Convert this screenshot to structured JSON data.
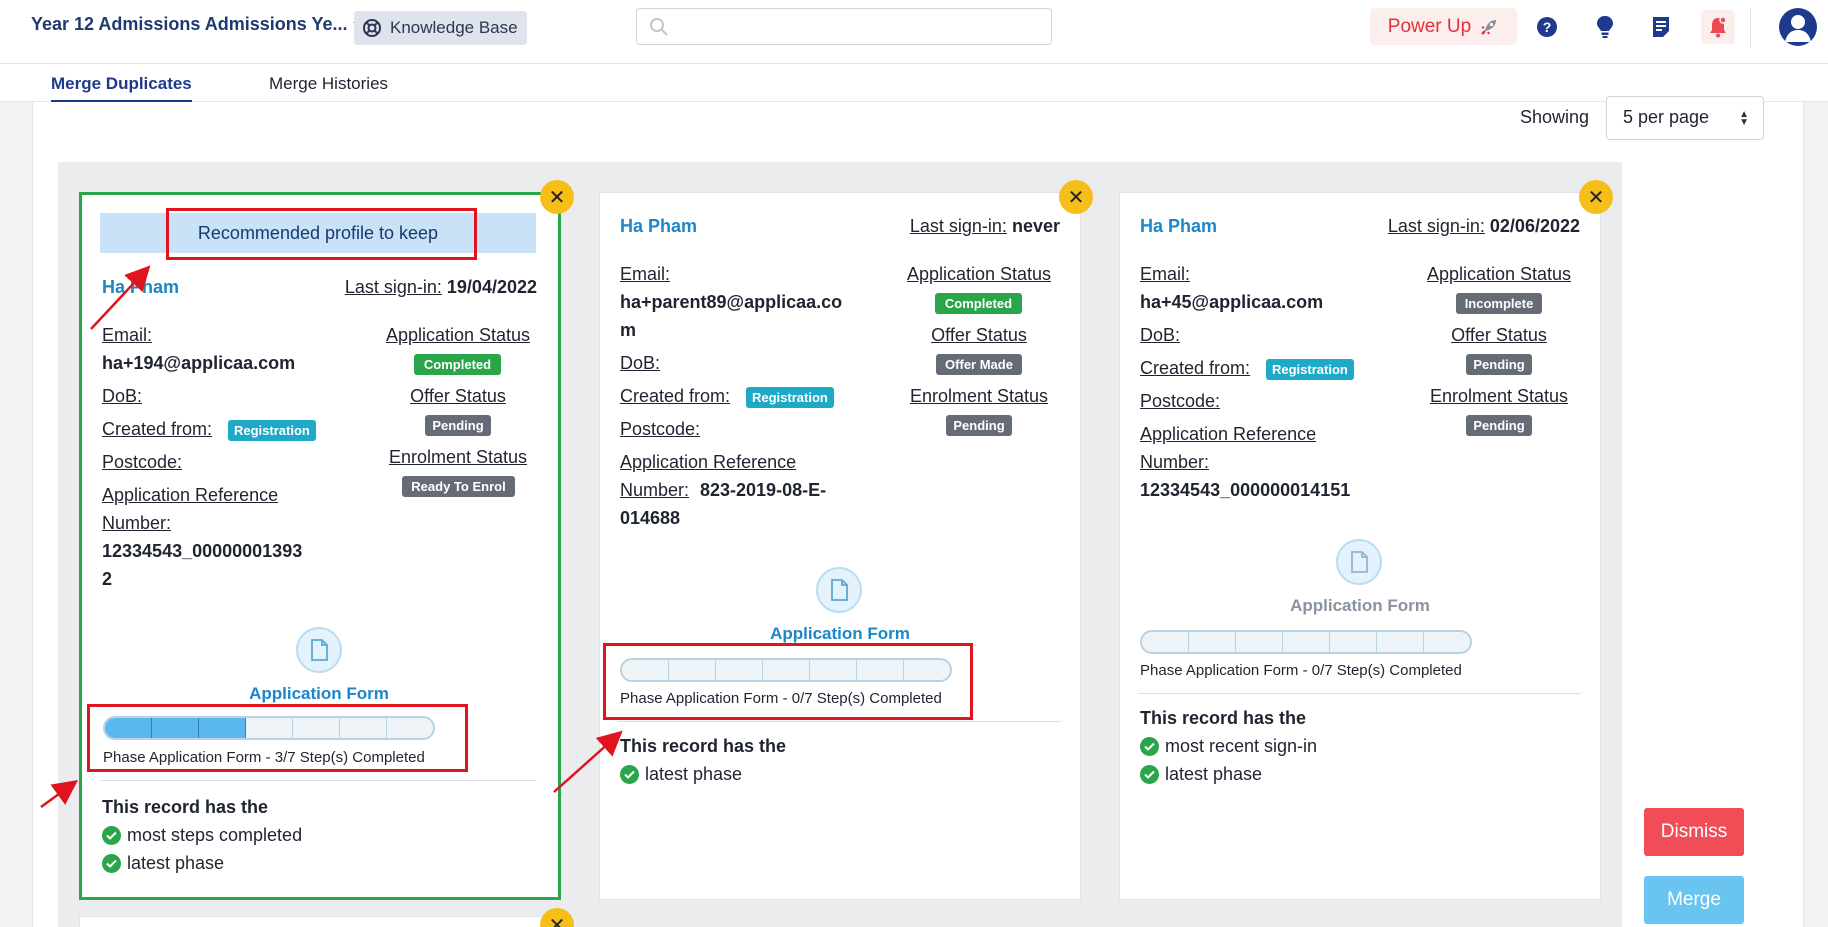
{
  "header": {
    "app_title": "Year 12 Admissions Admissions Ye...",
    "knowledge_base": "Knowledge Base",
    "search_placeholder": "",
    "power_up": "Power Up"
  },
  "tabs": [
    {
      "label": "Merge Duplicates",
      "active": true
    },
    {
      "label": "Merge Histories",
      "active": false
    }
  ],
  "paging": {
    "showing_label": "Showing",
    "per_page": "5 per page"
  },
  "labels": {
    "last_signin": "Last sign-in:",
    "email": "Email:",
    "dob": "DoB:",
    "created_from": "Created from:",
    "postcode": "Postcode:",
    "app_ref_1": "Application Reference",
    "app_ref_2": "Number:",
    "application_status": "Application Status",
    "offer_status": "Offer Status",
    "enrolment_status": "Enrolment Status",
    "record_has": "This record has the",
    "recommended": "Recommended profile to keep"
  },
  "cards": [
    {
      "name": "Ha Pham",
      "last_signin": "19/04/2022",
      "email_line1": "ha+194@applicaa.com",
      "email_line2": "",
      "created_from": "Registration",
      "ref_number_line1": "12334543_00000001393",
      "ref_number_line2": "2",
      "application_status": "Completed",
      "offer_status": "Pending",
      "enrolment_status": "Ready To Enrol",
      "phase_name": "Application Form",
      "progress_steps_completed": 3,
      "progress_steps_total": 7,
      "progress_text": "Phase Application Form - 3/7 Step(s) Completed",
      "record_items": [
        "most steps completed",
        "latest phase"
      ]
    },
    {
      "name": "Ha Pham",
      "last_signin": "never",
      "email_line1": "ha+parent89@applicaa.co",
      "email_line2": "m",
      "created_from": "Registration",
      "ref_inline": "823-2019-08-E-",
      "ref_number_line2": "014688",
      "application_status": "Completed",
      "offer_status": "Offer Made",
      "enrolment_status": "Pending",
      "phase_name": "Application Form",
      "progress_steps_completed": 0,
      "progress_steps_total": 7,
      "progress_text": "Phase Application Form - 0/7 Step(s) Completed",
      "record_items": [
        "latest phase"
      ]
    },
    {
      "name": "Ha Pham",
      "last_signin": "02/06/2022",
      "email_line1": "ha+45@applicaa.com",
      "email_line2": "",
      "created_from": "Registration",
      "ref_number_line1": "12334543_000000014151",
      "application_status": "Incomplete",
      "offer_status": "Pending",
      "enrolment_status": "Pending",
      "phase_name": "Application Form",
      "progress_steps_completed": 0,
      "progress_steps_total": 7,
      "progress_text": "Phase Application Form - 0/7 Step(s) Completed",
      "record_items": [
        "most recent sign-in",
        "latest phase"
      ]
    }
  ],
  "actions": {
    "dismiss": "Dismiss",
    "merge": "Merge"
  },
  "colors": {
    "brand_navy": "#1f3a8c",
    "link_blue": "#1c86c6",
    "recommended_border": "#2aa54a",
    "annotation_red": "#e0141e",
    "dismiss": "#f04d57",
    "merge": "#69c4ef",
    "close_badge": "#f5be18"
  },
  "icons": [
    "knowledge-base-icon",
    "search-icon",
    "rocket-icon",
    "help-icon",
    "lightbulb-icon",
    "notes-icon",
    "bell-icon",
    "user-avatar-icon",
    "close-icon",
    "document-icon",
    "check-icon"
  ]
}
